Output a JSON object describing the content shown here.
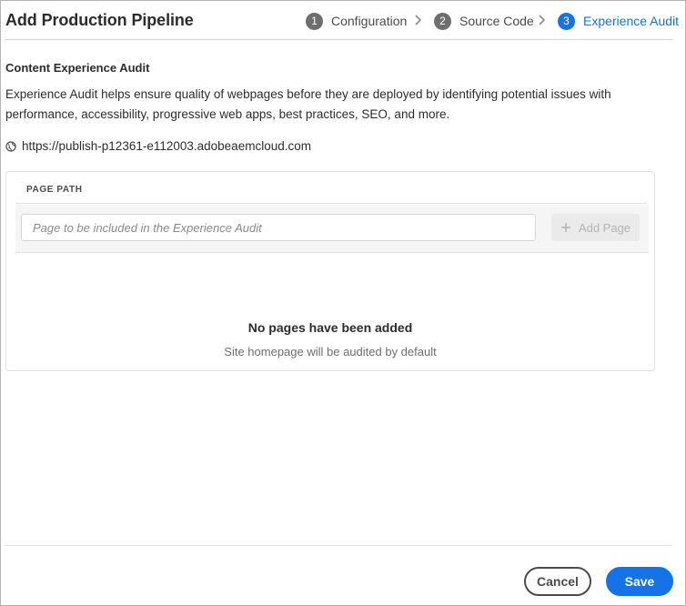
{
  "dialog": {
    "title": "Add Production Pipeline"
  },
  "stepper": {
    "steps": [
      {
        "number": "1",
        "label": "Configuration",
        "state": "complete"
      },
      {
        "number": "2",
        "label": "Source Code",
        "state": "complete"
      },
      {
        "number": "3",
        "label": "Experience Audit",
        "state": "active"
      }
    ],
    "active_color": "#1473e6",
    "inactive_color": "#6e6e6e"
  },
  "content": {
    "section_title": "Content Experience Audit",
    "description": "Experience Audit helps ensure quality of webpages before they are deployed by identifying potential issues with performance, accessibility, progressive web apps, best practices, SEO, and more.",
    "site_icon": "globe-icon",
    "site_url": "https://publish-p12361-e112003.adobeaemcloud.com"
  },
  "pages_table": {
    "column_header": "PAGE PATH",
    "input_value": "",
    "input_placeholder": "Page to be included in the Experience Audit",
    "add_button_icon": "plus-icon",
    "add_button_label": "Add Page",
    "add_button_disabled": true,
    "empty_title": "No pages have been added",
    "empty_subtitle": "Site homepage will be audited by default"
  },
  "footer": {
    "cancel_label": "Cancel",
    "save_label": "Save"
  }
}
